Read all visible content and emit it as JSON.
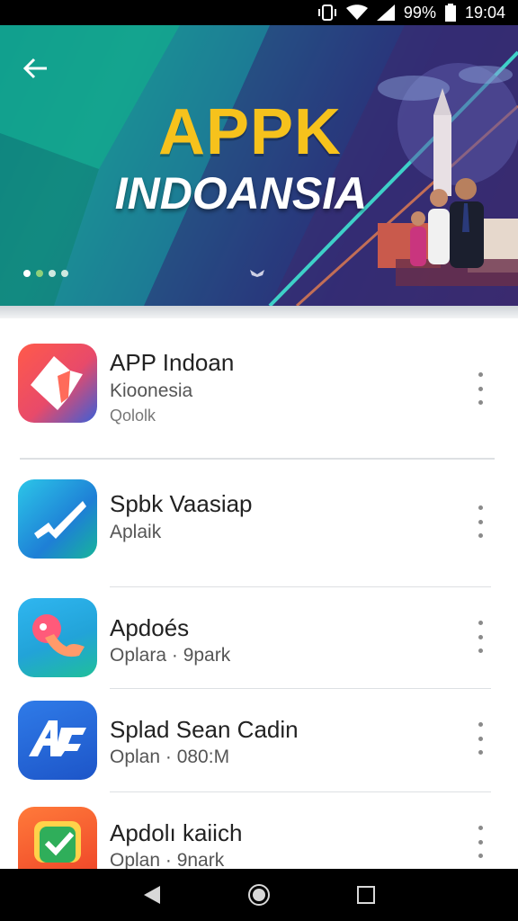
{
  "status_bar": {
    "battery": "99%",
    "time": "19:04"
  },
  "banner": {
    "title": "APPK",
    "subtitle": "INDOANSIA",
    "dots": 4
  },
  "apps": [
    {
      "title": "APP Indoan",
      "subtitle": "Kioonesia",
      "meta": "Qololk"
    },
    {
      "title": "Spbk Vaasiap",
      "subtitle": "Aplaik",
      "meta": ""
    },
    {
      "title": "Apdoés",
      "subtitle": "Oplara · 9park",
      "meta": ""
    },
    {
      "title": "Splad Sean Cadin",
      "subtitle": "Oplan · 080:M",
      "meta": ""
    },
    {
      "title": "Apdolı kaiich",
      "subtitle": "Oplan · 9nark",
      "meta": ""
    }
  ],
  "icons": {
    "back": "back-arrow-icon",
    "more": "more-vert-icon",
    "nav_back": "nav-back-icon",
    "nav_home": "nav-home-icon",
    "nav_recents": "nav-recents-icon"
  },
  "colors": {
    "banner_title": "#f6c21c",
    "banner_bg_start": "#0b8f8a",
    "banner_bg_end": "#3b2a6e"
  }
}
